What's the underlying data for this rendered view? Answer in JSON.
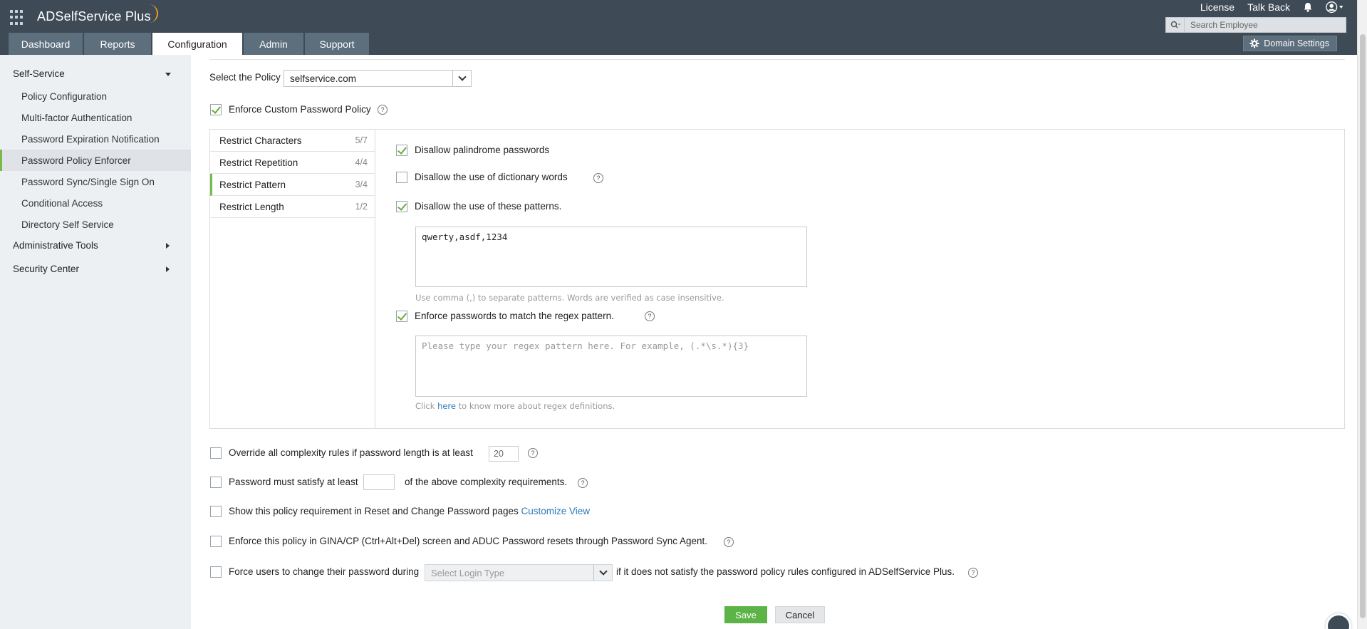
{
  "app": {
    "brand": "ADSelfService Plus",
    "top_links": [
      "License",
      "Talk Back"
    ],
    "search_placeholder": "Search Employee",
    "domain_settings": "Domain Settings",
    "colors": {
      "header": "#3e4b57",
      "accent": "#79b94b",
      "save": "#5cb346",
      "link": "#2a7ab8"
    }
  },
  "tabs": [
    "Dashboard",
    "Reports",
    "Configuration",
    "Admin",
    "Support"
  ],
  "active_tab": "Configuration",
  "sidebar": {
    "sections": [
      "Self-Service",
      "Administrative Tools",
      "Security Center"
    ],
    "items": [
      "Policy Configuration",
      "Multi-factor Authentication",
      "Password Expiration Notification",
      "Password Policy Enforcer",
      "Password Sync/Single Sign On",
      "Conditional Access",
      "Directory Self Service"
    ],
    "active_item": "Password Policy Enforcer"
  },
  "policy": {
    "select_label": "Select the Policy",
    "selected": "selfservice.com",
    "enforce_label": "Enforce Custom Password Policy"
  },
  "restrictions": [
    {
      "label": "Restrict Characters",
      "count": "5/7"
    },
    {
      "label": "Restrict Repetition",
      "count": "4/4"
    },
    {
      "label": "Restrict Pattern",
      "count": "3/4"
    },
    {
      "label": "Restrict Length",
      "count": "1/2"
    }
  ],
  "pattern": {
    "palindrome": "Disallow palindrome passwords",
    "dictionary": "Disallow the use of dictionary words",
    "patterns": "Disallow the use of these patterns.",
    "patterns_value": "qwerty,asdf,1234",
    "patterns_hint": "Use comma (,) to separate patterns. Words are verified as case insensitive.",
    "regex": "Enforce passwords to match the regex pattern.",
    "regex_placeholder": "Please type your regex pattern here. For example, (.*\\s.*){3}",
    "regex_hint_pre": "Click",
    "regex_hint_link": "here",
    "regex_hint_post": "to know more about regex definitions."
  },
  "options": {
    "override_label": "Override all complexity rules if password length is at least",
    "override_value": "20",
    "satisfy_pre": "Password must satisfy at least",
    "satisfy_post": "of the above complexity requirements.",
    "show_label": "Show this policy requirement in Reset and Change Password pages",
    "customize_link": "Customize View",
    "gina_label": "Enforce this policy in GINA/CP (Ctrl+Alt+Del) screen and ADUC Password resets through Password Sync Agent.",
    "force_pre": "Force users to change their password during",
    "login_placeholder": "Select Login Type",
    "force_post": "if it does not satisfy the password policy rules configured in ADSelfService Plus."
  },
  "buttons": {
    "save": "Save",
    "cancel": "Cancel"
  },
  "help_glyph": "?"
}
